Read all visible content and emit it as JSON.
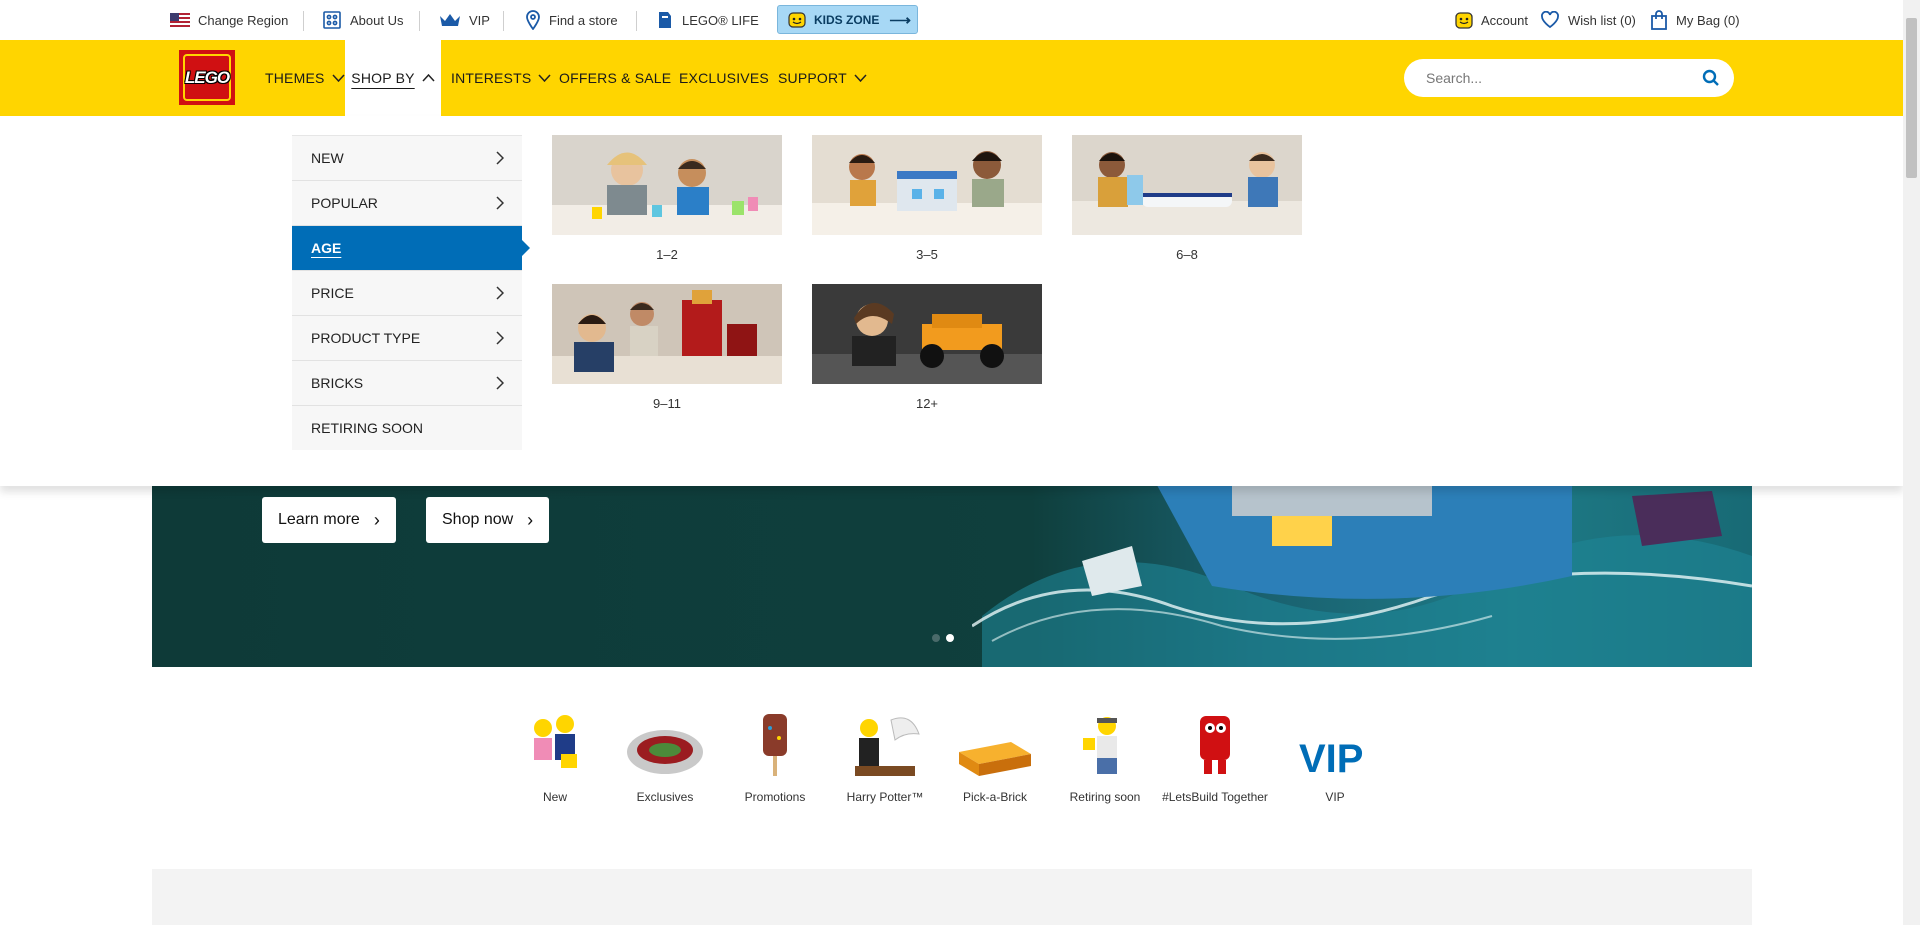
{
  "utility": {
    "change_region": "Change Region",
    "about_us": "About Us",
    "vip": "VIP",
    "find_store": "Find a store",
    "lego_life": "LEGO® LIFE",
    "kids_zone": "KIDS ZONE",
    "account": "Account",
    "wish_list": "Wish list (0)",
    "my_bag": "My Bag (0)"
  },
  "nav": {
    "logo": "LEGO",
    "themes": "THEMES",
    "shop_by": "SHOP BY",
    "interests": "INTERESTS",
    "offers": "OFFERS & SALE",
    "exclusives": "EXCLUSIVES",
    "support": "SUPPORT",
    "search_placeholder": "Search..."
  },
  "shop_by_menu": {
    "items": [
      {
        "label": "NEW",
        "has_arrow": true
      },
      {
        "label": "POPULAR",
        "has_arrow": true
      },
      {
        "label": "AGE",
        "has_arrow": false,
        "selected": true
      },
      {
        "label": "PRICE",
        "has_arrow": true
      },
      {
        "label": "PRODUCT TYPE",
        "has_arrow": true
      },
      {
        "label": "BRICKS",
        "has_arrow": true
      },
      {
        "label": "RETIRING SOON",
        "has_arrow": false
      }
    ],
    "ages": [
      "1–2",
      "3–5",
      "6–8",
      "9–11",
      "12+"
    ]
  },
  "hero": {
    "learn_more": "Learn more",
    "shop_now": "Shop now"
  },
  "quicklinks": [
    "New",
    "Exclusives",
    "Promotions",
    "Harry Potter™",
    "Pick-a-Brick",
    "Retiring soon",
    "#LetsBuild Together",
    "VIP"
  ],
  "colors": {
    "brand_yellow": "#ffd500",
    "lego_red": "#d01012",
    "selected_blue": "#006db7"
  }
}
